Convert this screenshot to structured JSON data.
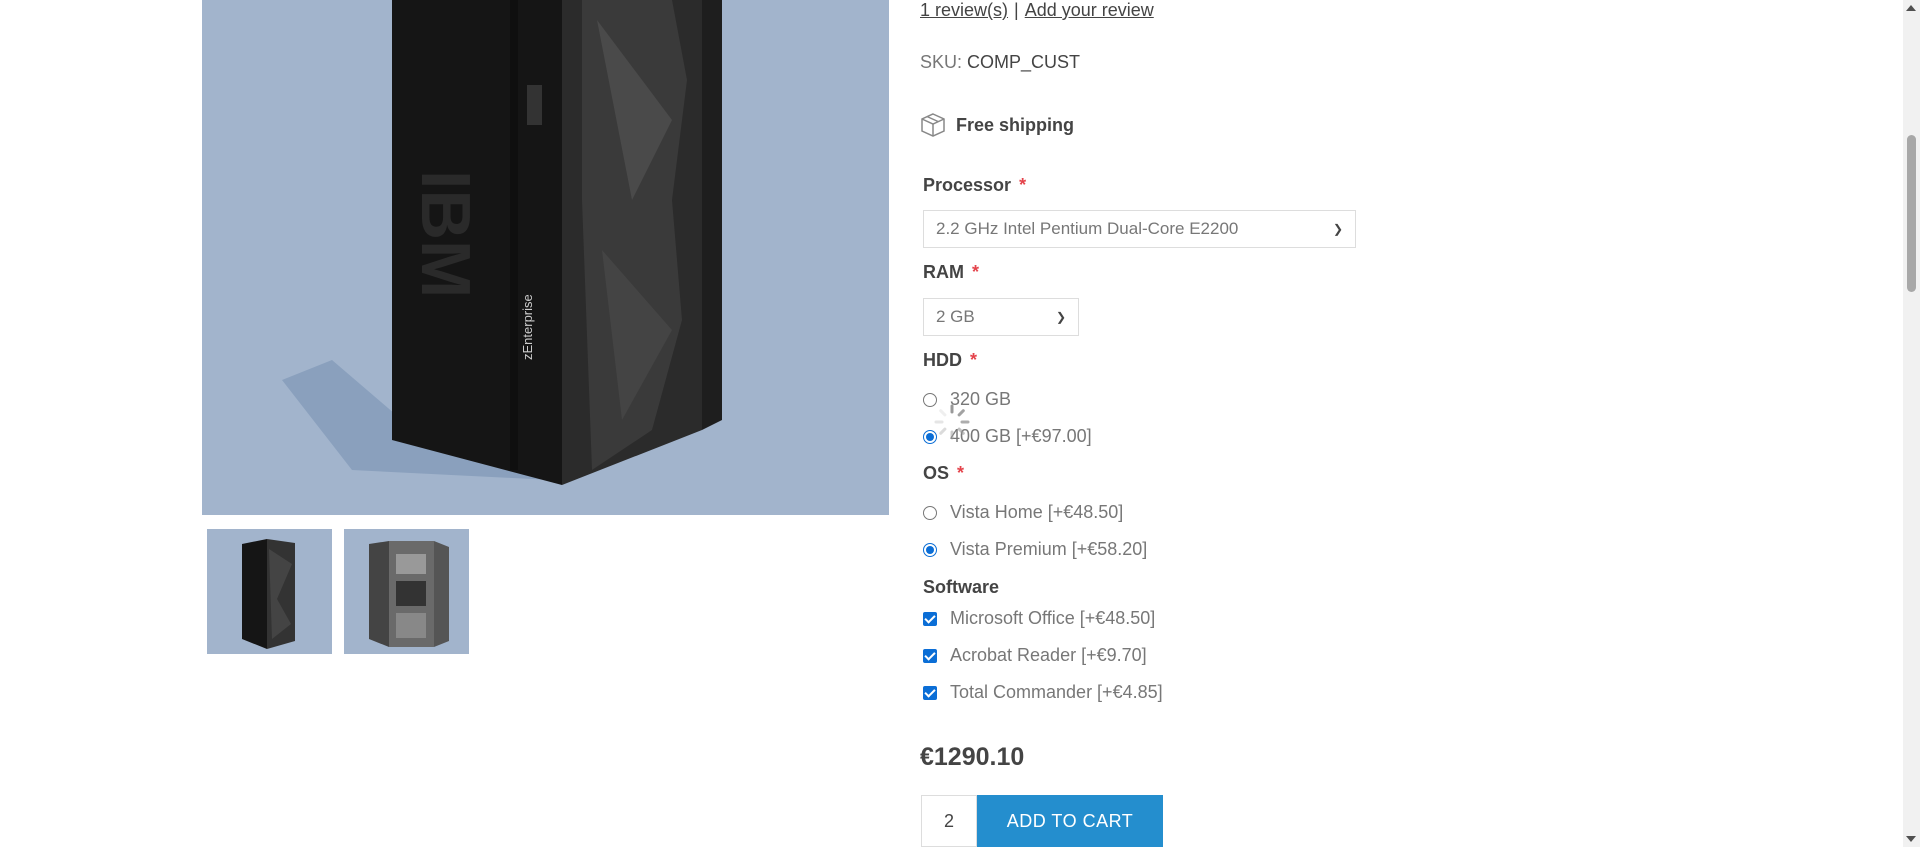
{
  "reviews": {
    "count_link": "1 review(s)",
    "separator": "|",
    "add_link": "Add your review"
  },
  "sku": {
    "label": "SKU:",
    "value": "COMP_CUST"
  },
  "shipping": {
    "label": "Free shipping",
    "icon": "package-icon"
  },
  "attributes": {
    "processor": {
      "label": "Processor",
      "required": "*",
      "selected": "2.2 GHz Intel Pentium Dual-Core E2200"
    },
    "ram": {
      "label": "RAM",
      "required": "*",
      "selected": "2 GB"
    },
    "hdd": {
      "label": "HDD",
      "required": "*",
      "options": [
        {
          "label": "320 GB",
          "checked": false
        },
        {
          "label": "400 GB [+€97.00]",
          "checked": true
        }
      ]
    },
    "os": {
      "label": "OS",
      "required": "*",
      "options": [
        {
          "label": "Vista Home [+€48.50]",
          "checked": false
        },
        {
          "label": "Vista Premium [+€58.20]",
          "checked": true
        }
      ]
    },
    "software": {
      "label": "Software",
      "options": [
        {
          "label": "Microsoft Office [+€48.50]",
          "checked": true
        },
        {
          "label": "Acrobat Reader [+€9.70]",
          "checked": true
        },
        {
          "label": "Total Commander [+€4.85]",
          "checked": true
        }
      ]
    }
  },
  "price": "€1290.10",
  "quantity": "2",
  "add_to_cart": "ADD TO CART",
  "product_image": {
    "brand_text": "IBM",
    "model_text": "zEnterprise"
  },
  "colors": {
    "accent": "#248ece",
    "radio_check": "#0b6ed6",
    "required": "#e4434b",
    "image_bg": "#a2b4cc"
  }
}
